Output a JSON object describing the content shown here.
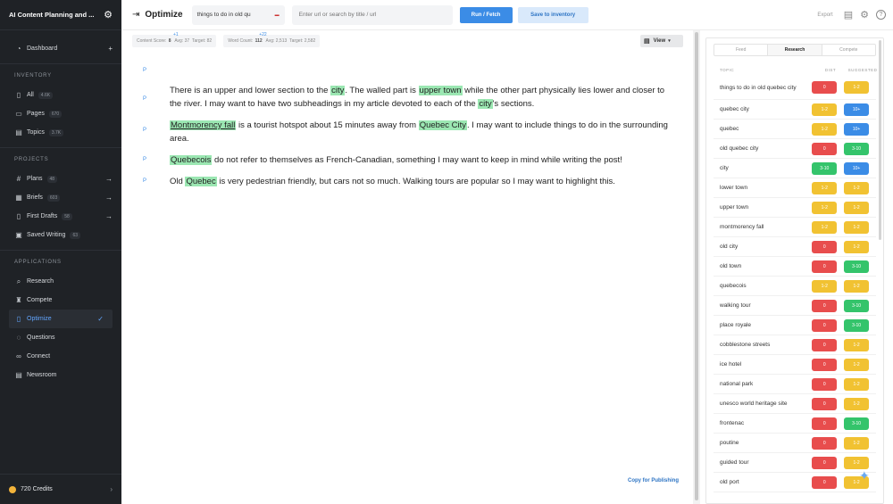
{
  "sidebar": {
    "title": "AI Content Planning and ...",
    "dashboard": "Dashboard",
    "sections": {
      "inventory": "INVENTORY",
      "projects": "PROJECTS",
      "applications": "APPLICATIONS"
    },
    "inventory": [
      {
        "label": "All",
        "count": "4.6K"
      },
      {
        "label": "Pages",
        "count": "670"
      },
      {
        "label": "Topics",
        "count": "3.7K"
      }
    ],
    "projects": [
      {
        "label": "Plans",
        "count": "48"
      },
      {
        "label": "Briefs",
        "count": "603"
      },
      {
        "label": "First Drafts",
        "count": "58"
      },
      {
        "label": "Saved Writing",
        "count": "63"
      }
    ],
    "applications": [
      "Research",
      "Compete",
      "Optimize",
      "Questions",
      "Connect",
      "Newsroom"
    ],
    "credits": "720 Credits"
  },
  "topbar": {
    "title": "Optimize",
    "keyword": "things to do in old qu",
    "url_placeholder": "Enter url or search by title / url",
    "run_label": "Run / Fetch",
    "save_label": "Save to inventory",
    "export_label": "Export"
  },
  "scores": {
    "content_label": "Content Score:",
    "content_value": "8",
    "content_delta": "+1",
    "content_avg": "Avg: 37",
    "content_target": "Target: 82",
    "word_label": "Word Count:",
    "word_value": "112",
    "word_delta": "+22",
    "word_avg": "Avg: 2,513",
    "word_target": "Target: 2,582"
  },
  "editor": {
    "view_label": "View",
    "marker": "P",
    "copy_label": "Copy for Publishing"
  },
  "panel": {
    "tabs": [
      "Feed",
      "Research",
      "Compete"
    ],
    "active_tab": "Research",
    "headers": {
      "topic": "TOPIC",
      "dist": "DIST",
      "suggested": "SUGGESTED"
    },
    "colors": {
      "red": "#e84d4d",
      "yellow": "#f1c232",
      "green": "#34c46b",
      "blue": "#3b8ce6"
    },
    "rows": [
      {
        "topic": "things to do in old quebec city",
        "dist": "0",
        "dist_color": "red",
        "sug": "1-2",
        "sug_color": "yellow"
      },
      {
        "topic": "quebec city",
        "dist": "1-2",
        "dist_color": "yellow",
        "sug": "10+",
        "sug_color": "blue"
      },
      {
        "topic": "quebec",
        "dist": "1-2",
        "dist_color": "yellow",
        "sug": "10+",
        "sug_color": "blue"
      },
      {
        "topic": "old quebec city",
        "dist": "0",
        "dist_color": "red",
        "sug": "3-10",
        "sug_color": "green"
      },
      {
        "topic": "city",
        "dist": "3-10",
        "dist_color": "green",
        "sug": "10+",
        "sug_color": "blue"
      },
      {
        "topic": "lower town",
        "dist": "1-2",
        "dist_color": "yellow",
        "sug": "1-2",
        "sug_color": "yellow"
      },
      {
        "topic": "upper town",
        "dist": "1-2",
        "dist_color": "yellow",
        "sug": "1-2",
        "sug_color": "yellow"
      },
      {
        "topic": "montmorency fall",
        "dist": "1-2",
        "dist_color": "yellow",
        "sug": "1-2",
        "sug_color": "yellow"
      },
      {
        "topic": "old city",
        "dist": "0",
        "dist_color": "red",
        "sug": "1-2",
        "sug_color": "yellow"
      },
      {
        "topic": "old town",
        "dist": "0",
        "dist_color": "red",
        "sug": "3-10",
        "sug_color": "green"
      },
      {
        "topic": "quebecois",
        "dist": "1-2",
        "dist_color": "yellow",
        "sug": "1-2",
        "sug_color": "yellow"
      },
      {
        "topic": "walking tour",
        "dist": "0",
        "dist_color": "red",
        "sug": "3-10",
        "sug_color": "green"
      },
      {
        "topic": "place royale",
        "dist": "0",
        "dist_color": "red",
        "sug": "3-10",
        "sug_color": "green"
      },
      {
        "topic": "cobblestone streets",
        "dist": "0",
        "dist_color": "red",
        "sug": "1-2",
        "sug_color": "yellow"
      },
      {
        "topic": "ice hotel",
        "dist": "0",
        "dist_color": "red",
        "sug": "1-2",
        "sug_color": "yellow"
      },
      {
        "topic": "national park",
        "dist": "0",
        "dist_color": "red",
        "sug": "1-2",
        "sug_color": "yellow"
      },
      {
        "topic": "unesco world heritage site",
        "dist": "0",
        "dist_color": "red",
        "sug": "1-2",
        "sug_color": "yellow"
      },
      {
        "topic": "frontenac",
        "dist": "0",
        "dist_color": "red",
        "sug": "3-10",
        "sug_color": "green"
      },
      {
        "topic": "poutine",
        "dist": "0",
        "dist_color": "red",
        "sug": "1-2",
        "sug_color": "yellow"
      },
      {
        "topic": "guided tour",
        "dist": "0",
        "dist_color": "red",
        "sug": "1-2",
        "sug_color": "yellow"
      },
      {
        "topic": "old port",
        "dist": "0",
        "dist_color": "red",
        "sug": "1-2",
        "sug_color": "yellow"
      }
    ]
  },
  "paragraphs": {
    "p1": {
      "t1": "There is an upper and lower section to the ",
      "h1": "city",
      "t2": ". The walled part is ",
      "h2": "upper town",
      "t3": " while the other part physically lies lower and closer to the river. I may want to have two subheadings in my article devoted to each of the ",
      "h3": "city",
      "t4": "'s sections."
    },
    "p2": {
      "h1": "Montmorency fall",
      "t1": " is a tourist hotspot about 15 minutes away from ",
      "h2": "Quebec City",
      "t2": ". I may want to include things to do in the surrounding area."
    },
    "p3": {
      "h1": "Quebecois",
      "t1": " do not refer to themselves as French-Canadian, something I may want to keep in mind while writing the post!"
    },
    "p4": {
      "t1": "Old ",
      "h1": "Quebec",
      "t2": " is very pedestrian friendly, but cars not so much. Walking tours are popular so I may want to highlight this."
    }
  }
}
